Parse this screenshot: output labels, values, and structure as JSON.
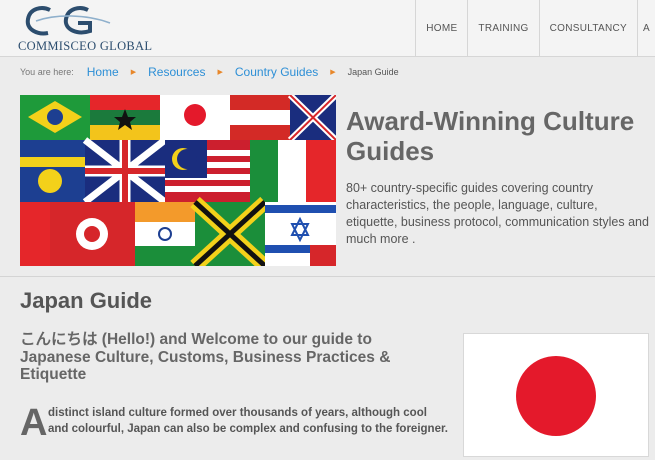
{
  "brand": {
    "name": "COMMISCEO GLOBAL",
    "logo_letters": "CG"
  },
  "nav": {
    "items": [
      "HOME",
      "TRAINING",
      "CONSULTANCY",
      "A"
    ]
  },
  "breadcrumb": {
    "label": "You are here:",
    "links": [
      "Home",
      "Resources",
      "Country Guides"
    ],
    "current": "Japan Guide",
    "separator": "▶"
  },
  "banner": {
    "title": "Award-Winning Culture Guides",
    "description": "80+ country-specific guides covering country characteristics, the people, language, culture, etiquette, business protocol, communication styles and much more ."
  },
  "content": {
    "page_title": "Japan Guide",
    "welcome": "こんにちは (Hello!) and Welcome to our guide to Japanese Culture, Customs, Business Practices & Etiquette",
    "dropcap": "A",
    "intro": "distinct island culture formed over thousands of years, although cool and colourful, Japan can also be complex and confusing to the foreigner."
  },
  "colors": {
    "link": "#2d8fd6",
    "separator": "#e8872a",
    "brand": "#2c4d6e",
    "flag_red": "#e4192b"
  }
}
